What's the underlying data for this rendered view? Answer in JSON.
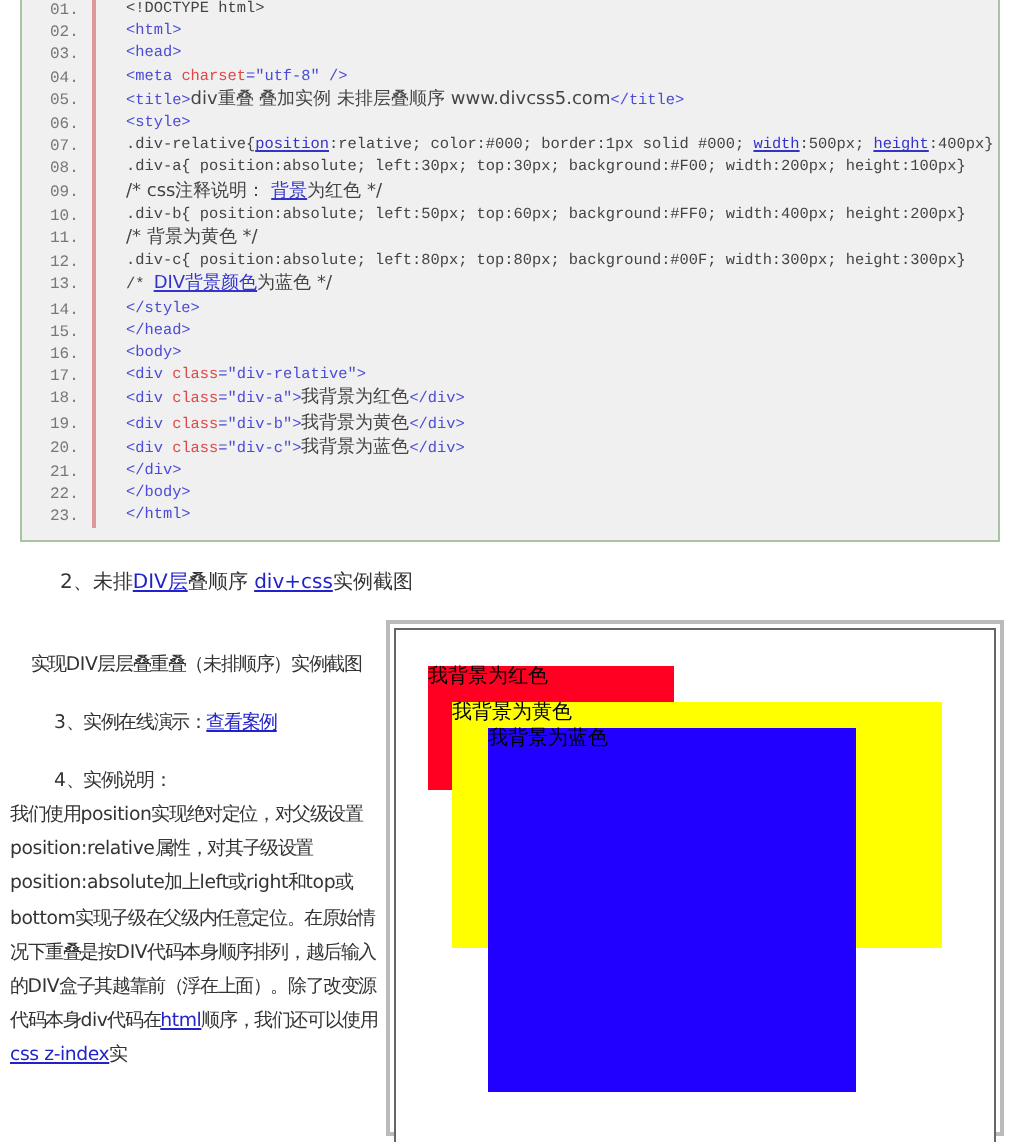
{
  "code_listing": {
    "lines": [
      {
        "number": "01.",
        "segments": [
          {
            "kind": "text",
            "text": "<!DOCTYPE html>"
          }
        ]
      },
      {
        "number": "02.",
        "segments": [
          {
            "kind": "tag",
            "text": "<html>"
          }
        ]
      },
      {
        "number": "03.",
        "segments": [
          {
            "kind": "tag",
            "text": "<head>"
          }
        ]
      },
      {
        "number": "04.",
        "segments": [
          {
            "kind": "tag",
            "text": "<meta "
          },
          {
            "kind": "attr",
            "text": "charset"
          },
          {
            "kind": "value",
            "text": "=\"utf-8\""
          },
          {
            "kind": "tag",
            "text": " />"
          }
        ]
      },
      {
        "number": "05.",
        "segments": [
          {
            "kind": "tag",
            "text": "<title>"
          },
          {
            "kind": "text",
            "text": "div重叠 叠加实例 未排层叠顺序 www.divcss5.com"
          },
          {
            "kind": "tag",
            "text": "</title>"
          }
        ]
      },
      {
        "number": "06.",
        "segments": [
          {
            "kind": "tag",
            "text": "<style>"
          }
        ]
      },
      {
        "number": "07.",
        "segments": [
          {
            "kind": "text",
            "text": ".div-relative{"
          },
          {
            "kind": "link",
            "text": "position"
          },
          {
            "kind": "text",
            "text": ":relative; color:#000; border:1px solid #000; "
          },
          {
            "kind": "link",
            "text": "width"
          },
          {
            "kind": "text",
            "text": ":500px; "
          },
          {
            "kind": "link",
            "text": "height"
          },
          {
            "kind": "text",
            "text": ":400px}"
          }
        ]
      },
      {
        "number": "08.",
        "segments": [
          {
            "kind": "text",
            "text": ".div-a{ position:absolute; left:30px; top:30px; background:#F00; width:200px; height:100px}"
          }
        ]
      },
      {
        "number": "09.",
        "segments": [
          {
            "kind": "text",
            "text": "/* css注释说明： "
          },
          {
            "kind": "link",
            "text": "背景"
          },
          {
            "kind": "text",
            "text": "为红色 */"
          }
        ]
      },
      {
        "number": "10.",
        "segments": [
          {
            "kind": "text",
            "text": ".div-b{ position:absolute; left:50px; top:60px; background:#FF0; width:400px; height:200px}"
          }
        ]
      },
      {
        "number": "11.",
        "segments": [
          {
            "kind": "text",
            "text": "/* 背景为黄色 */"
          }
        ]
      },
      {
        "number": "12.",
        "segments": [
          {
            "kind": "text",
            "text": ".div-c{ position:absolute; left:80px; top:80px; background:#00F; width:300px; height:300px}"
          }
        ]
      },
      {
        "number": "13.",
        "segments": [
          {
            "kind": "text",
            "text": "/* "
          },
          {
            "kind": "link",
            "text": "DIV背景颜色"
          },
          {
            "kind": "text",
            "text": "为蓝色 */"
          }
        ]
      },
      {
        "number": "14.",
        "segments": [
          {
            "kind": "tag",
            "text": "</style>"
          }
        ]
      },
      {
        "number": "15.",
        "segments": [
          {
            "kind": "tag",
            "text": "</head>"
          }
        ]
      },
      {
        "number": "16.",
        "segments": [
          {
            "kind": "tag",
            "text": "<body>"
          }
        ]
      },
      {
        "number": "17.",
        "segments": [
          {
            "kind": "tag",
            "text": "<div "
          },
          {
            "kind": "attr",
            "text": "class"
          },
          {
            "kind": "value",
            "text": "=\"div-relative\""
          },
          {
            "kind": "tag",
            "text": ">"
          }
        ]
      },
      {
        "number": "18.",
        "segments": [
          {
            "kind": "tag",
            "text": "<div "
          },
          {
            "kind": "attr",
            "text": "class"
          },
          {
            "kind": "value",
            "text": "=\"div-a\""
          },
          {
            "kind": "tag",
            "text": ">"
          },
          {
            "kind": "text",
            "text": "我背景为红色"
          },
          {
            "kind": "tag",
            "text": "</div>"
          }
        ]
      },
      {
        "number": "19.",
        "segments": [
          {
            "kind": "tag",
            "text": "<div "
          },
          {
            "kind": "attr",
            "text": "class"
          },
          {
            "kind": "value",
            "text": "=\"div-b\""
          },
          {
            "kind": "tag",
            "text": ">"
          },
          {
            "kind": "text",
            "text": "我背景为黄色"
          },
          {
            "kind": "tag",
            "text": "</div>"
          }
        ]
      },
      {
        "number": "20.",
        "segments": [
          {
            "kind": "tag",
            "text": "<div "
          },
          {
            "kind": "attr",
            "text": "class"
          },
          {
            "kind": "value",
            "text": "=\"div-c\""
          },
          {
            "kind": "tag",
            "text": ">"
          },
          {
            "kind": "text",
            "text": "我背景为蓝色"
          },
          {
            "kind": "tag",
            "text": "</div>"
          }
        ]
      },
      {
        "number": "21.",
        "segments": [
          {
            "kind": "tag",
            "text": "</div>"
          }
        ]
      },
      {
        "number": "22.",
        "segments": [
          {
            "kind": "tag",
            "text": "</body>"
          }
        ]
      },
      {
        "number": "23.",
        "segments": [
          {
            "kind": "tag",
            "text": "</html>"
          }
        ]
      }
    ]
  },
  "step_2_heading": [
    {
      "kind": "text",
      "text": "2、未排"
    },
    {
      "kind": "link",
      "text": "DIV层"
    },
    {
      "kind": "text",
      "text": "叠顺序 "
    },
    {
      "kind": "link",
      "text": "div+css"
    },
    {
      "kind": "text",
      "text": "实例截图"
    }
  ],
  "screenshot_caption": "实现DIV层层叠重叠（未排顺序）实例截图",
  "step_3": [
    {
      "kind": "text",
      "text": "3、实例在线演示："
    },
    {
      "kind": "link",
      "text": "查看案例"
    }
  ],
  "step_4_heading": "4、实例说明：",
  "explanation": [
    {
      "kind": "text",
      "text": "我们使用position实现绝对定位，对父级设置position:relative属性，对其子级设置position:absolute加上left或right和top或bottom实现子级在父级内任意定位。在原始情况下重叠是按DIV代码本身顺序排列，越后输入的DIV盒子其越靠前（浮在上面）。除了改变源代码本身div代码在"
    },
    {
      "kind": "link",
      "text": "html"
    },
    {
      "kind": "text",
      "text": "顺序，我们还可以使用"
    },
    {
      "kind": "link",
      "text": "css z-index"
    },
    {
      "kind": "text",
      "text": "实"
    }
  ],
  "demo_screenshot": {
    "boxes": [
      {
        "label": "我背景为红色",
        "color": "#ff0022"
      },
      {
        "label": "我背景为黄色",
        "color": "#ffff00"
      },
      {
        "label": "我背景为蓝色",
        "color": "#2200ff"
      }
    ]
  }
}
